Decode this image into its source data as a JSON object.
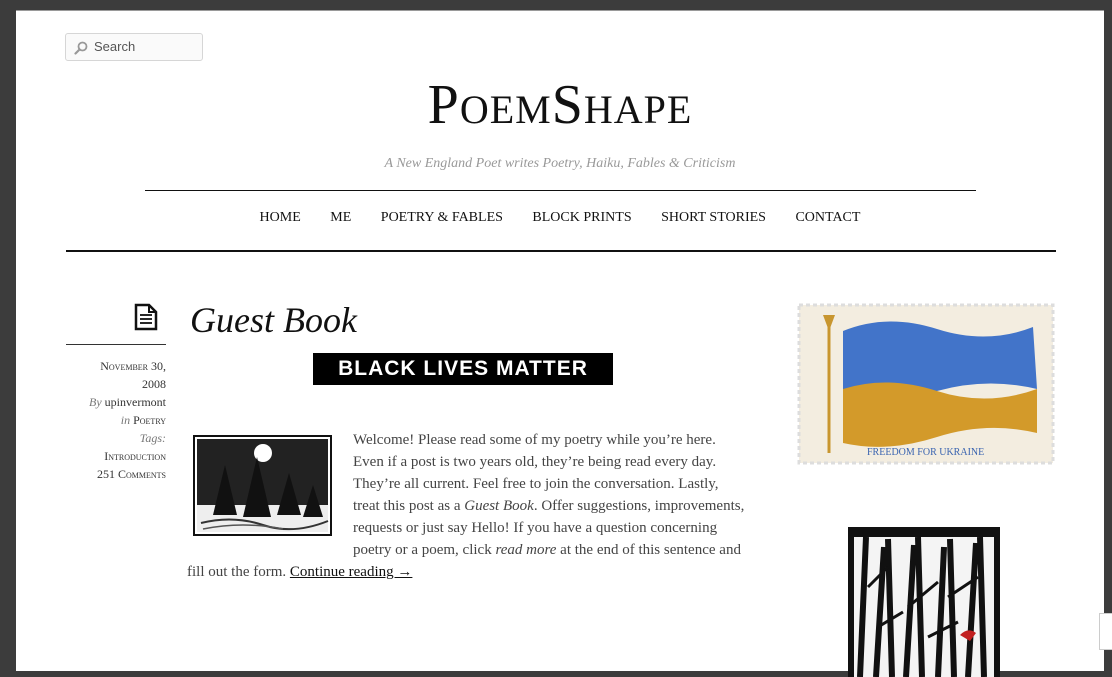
{
  "search": {
    "placeholder": "Search"
  },
  "header": {
    "title_first_cap": "P",
    "title_first_rest": "OEM",
    "title_second_cap": "S",
    "title_second_rest": "HAPE",
    "tagline": "A New England Poet writes Poetry, Haiku, Fables & Criticism"
  },
  "nav": {
    "items": [
      {
        "label": "HOME"
      },
      {
        "label": "ME"
      },
      {
        "label": "POETRY & FABLES"
      },
      {
        "label": "BLOCK PRINTS"
      },
      {
        "label": "SHORT STORIES"
      },
      {
        "label": "CONTACT"
      }
    ]
  },
  "post": {
    "title": "Guest Book",
    "banner": "BLACK LIVES MATTER",
    "meta": {
      "date_line1": "November 30,",
      "date_line2": "2008",
      "by_label": "By",
      "author": "upinvermont",
      "in_label": "in",
      "category": "Poetry",
      "tags_label": "Tags:",
      "tag": "Introduction",
      "comments": "251 Comments"
    },
    "body": {
      "p1": "Welcome!  Please read some of my poetry while you’re here. Even if a post is two years old, they’re being read every day. They’re all current. Feel free to join the conversation. Lastly, treat this post as a ",
      "p1_em": "Guest Book",
      "p2": ". Offer suggestions, improvements, requests or just say Hello! If you have a question concerning poetry or a poem, click ",
      "p2_em": "read more",
      "p3": " at the end of this sentence and fill out the form. ",
      "continue": "Continue reading →"
    }
  },
  "sidebar": {
    "stamp_caption": "FREEDOM FOR UKRAINE",
    "colors": {
      "blue": "#3f6fc6",
      "gold": "#d49a27"
    }
  }
}
